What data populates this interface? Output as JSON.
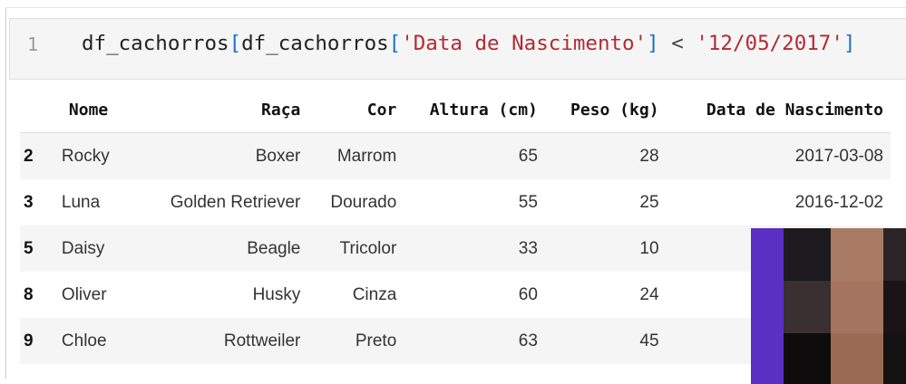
{
  "code": {
    "line_number": "1",
    "tokens": [
      {
        "t": "df_cachorros",
        "c": "plain"
      },
      {
        "t": "[",
        "c": "br"
      },
      {
        "t": "df_cachorros",
        "c": "plain"
      },
      {
        "t": "[",
        "c": "br"
      },
      {
        "t": "'Data de Nascimento'",
        "c": "str"
      },
      {
        "t": "]",
        "c": "br"
      },
      {
        "t": " < ",
        "c": "op"
      },
      {
        "t": "'12/05/2017'",
        "c": "str"
      },
      {
        "t": "]",
        "c": "br"
      }
    ]
  },
  "table": {
    "columns": [
      "",
      "Nome",
      "Raça",
      "Cor",
      "Altura (cm)",
      "Peso (kg)",
      "Data de Nascimento"
    ],
    "rows": [
      {
        "idx": "2",
        "nome": "Rocky",
        "raca": "Boxer",
        "cor": "Marrom",
        "altura": "65",
        "peso": "28",
        "data": "2017-03-08"
      },
      {
        "idx": "3",
        "nome": "Luna",
        "raca": "Golden Retriever",
        "cor": "Dourado",
        "altura": "55",
        "peso": "25",
        "data": "2016-12-02"
      },
      {
        "idx": "5",
        "nome": "Daisy",
        "raca": "Beagle",
        "cor": "Tricolor",
        "altura": "33",
        "peso": "10",
        "data": ""
      },
      {
        "idx": "8",
        "nome": "Oliver",
        "raca": "Husky",
        "cor": "Cinza",
        "altura": "60",
        "peso": "24",
        "data": ""
      },
      {
        "idx": "9",
        "nome": "Chloe",
        "raca": "Rottweiler",
        "cor": "Preto",
        "altura": "63",
        "peso": "45",
        "data": ""
      }
    ]
  },
  "overlay": {
    "colors": [
      "#5a2fc4",
      "#1c1a1f",
      "#a87a63",
      "#2a2426",
      "#5a2fc4",
      "#3a3032",
      "#a47460",
      "#1a1416",
      "#5a2fc4",
      "#0d0b0c",
      "#9a6a52",
      "#151213"
    ]
  }
}
